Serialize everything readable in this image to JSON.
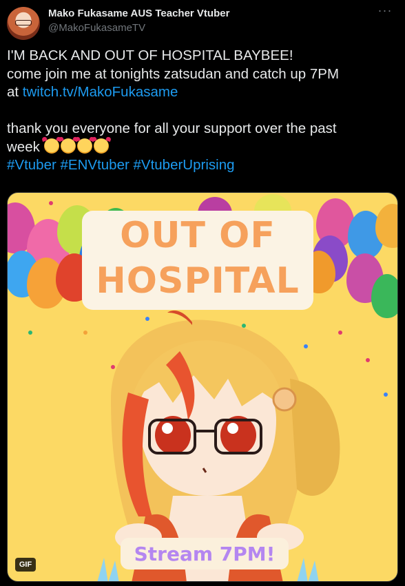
{
  "author": {
    "display_name": "Mako Fukasame AUS Teacher Vtuber",
    "handle": "@MakoFukasameTV",
    "more_icon": "more-dots-icon"
  },
  "tweet": {
    "line1": "I'M BACK AND OUT OF HOSPITAL BAYBEE!",
    "line2": "come join me at tonights zatsudan and catch up 7PM",
    "line3_prefix": "at ",
    "link": "twitch.tv/MakoFukasame",
    "line4": "thank you everyone for all your support over the past",
    "line5_prefix": "week ",
    "emoji_name": "smiling-face-with-hearts",
    "emoji_count": 4,
    "hashtags": [
      "#Vtuber",
      "#ENVtuber",
      "#VtuberUprising"
    ]
  },
  "media": {
    "title_line1": "OUT OF",
    "title_line2": "HOSPITAL",
    "stream_label": "Stream 7PM!",
    "gif_label": "GIF"
  },
  "colors": {
    "background": "#000000",
    "text": "#e7e9ea",
    "secondary": "#71767b",
    "link": "#1d9bf0",
    "media_bg": "#fcd964",
    "title_text": "#f6a15c",
    "stream_text": "#b486f0"
  }
}
